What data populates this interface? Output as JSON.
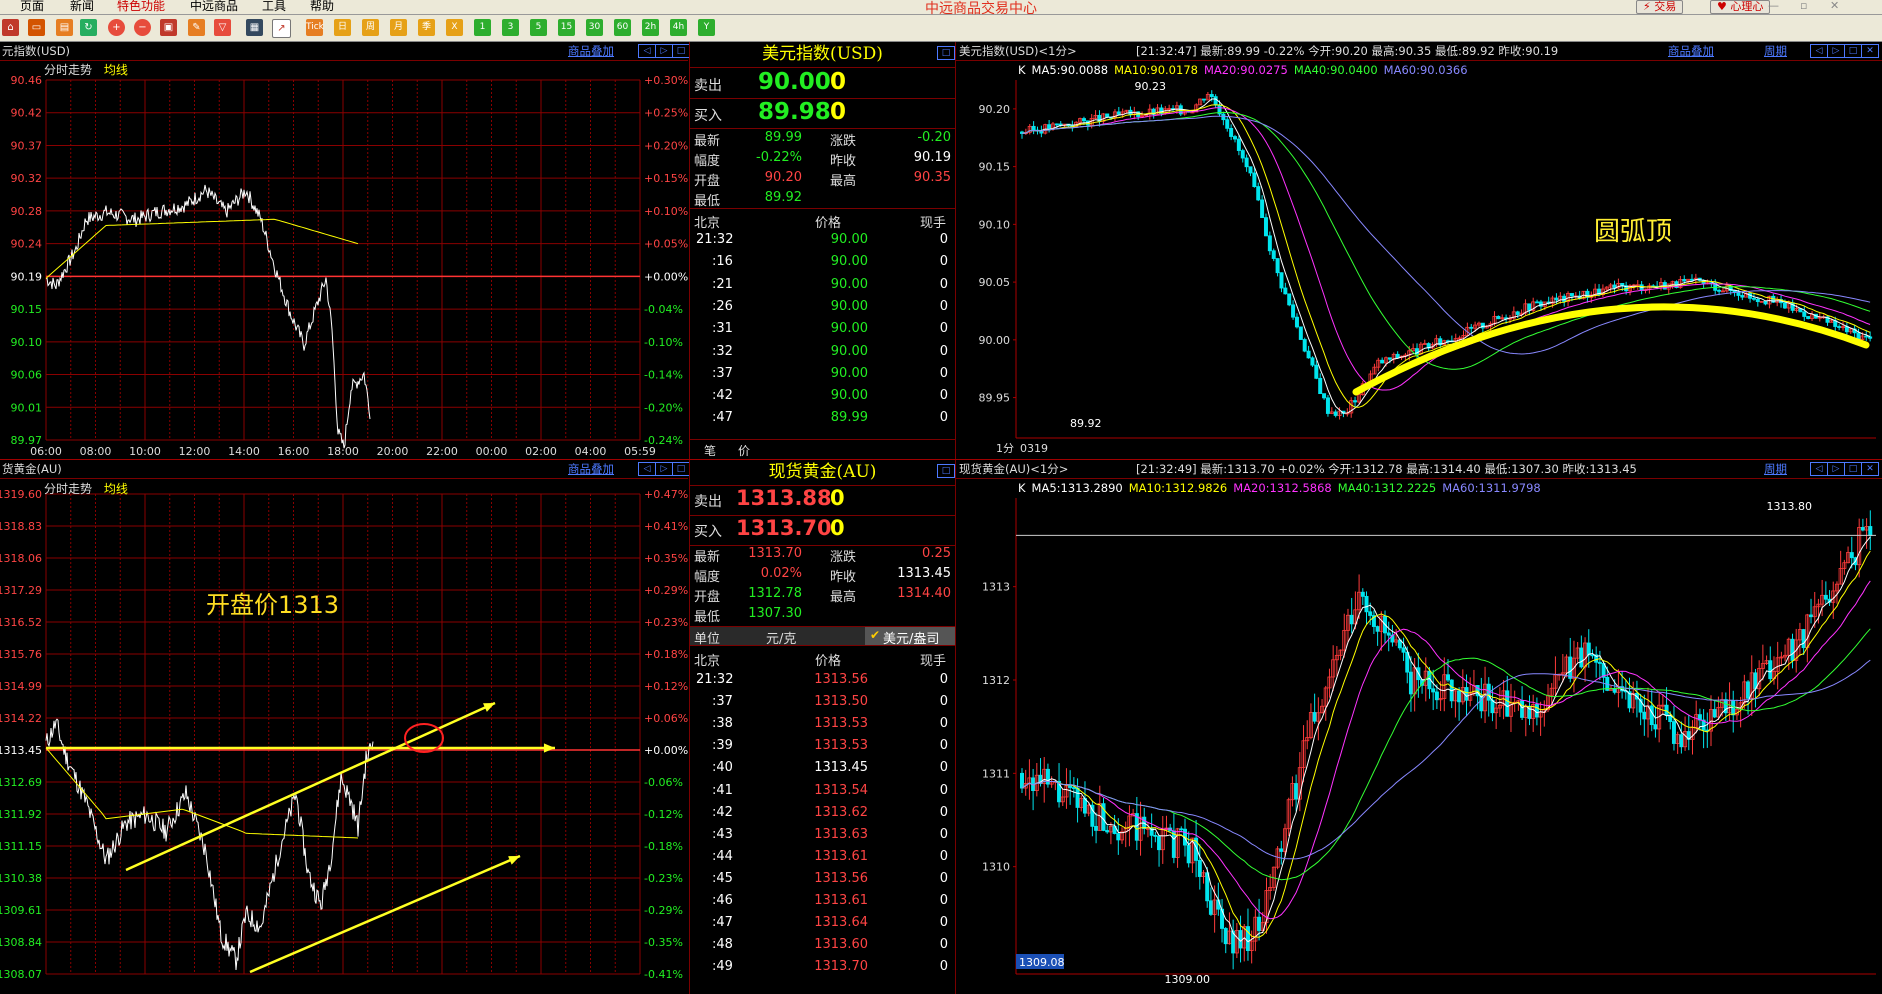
{
  "menu": {
    "items": [
      "页面",
      "新闻",
      "特色功能",
      "中远商品",
      "工具",
      "帮助"
    ],
    "app_title": "中远商品交易中心",
    "trade_btn": "交易",
    "center_btn": "心理心"
  },
  "toolbar": {
    "period_buttons": [
      "Tick",
      "日",
      "周",
      "月",
      "季",
      "X",
      "1",
      "3",
      "5",
      "15",
      "30",
      "60",
      "2h",
      "4h",
      "Y"
    ]
  },
  "usd_intraday": {
    "title": "元指数(USD)",
    "overlay_link": "商品叠加",
    "legend_time": "分时走势",
    "legend_avg": "均线",
    "price_ticks": [
      "90.46",
      "90.42",
      "90.37",
      "90.32",
      "90.28",
      "90.24",
      "90.19",
      "90.15",
      "90.10",
      "90.06",
      "90.01",
      "89.97"
    ],
    "pct_ticks": [
      "+0.30%",
      "+0.25%",
      "+0.20%",
      "+0.15%",
      "+0.10%",
      "+0.05%",
      "+0.00%",
      "-0.04%",
      "-0.10%",
      "-0.14%",
      "-0.20%",
      "-0.24%"
    ],
    "time_ticks": [
      "06:00",
      "08:00",
      "10:00",
      "12:00",
      "14:00",
      "16:00",
      "18:00",
      "20:00",
      "22:00",
      "00:00",
      "02:00",
      "04:00",
      "05:59"
    ]
  },
  "usd_quote": {
    "title": "美元指数(USD)",
    "sell_label": "卖出",
    "sell_price": "90.00",
    "sell_vol": "0",
    "buy_label": "买入",
    "buy_price": "89.98",
    "buy_vol": "0",
    "rows": [
      {
        "l1": "最新",
        "v1": "89.99",
        "c1": "g",
        "l2": "涨跌",
        "v2": "-0.20",
        "c2": "g"
      },
      {
        "l1": "幅度",
        "v1": "-0.22%",
        "c1": "g",
        "l2": "昨收",
        "v2": "90.19",
        "c2": "w"
      },
      {
        "l1": "开盘",
        "v1": "90.20",
        "c1": "r",
        "l2": "最高",
        "v2": "90.35",
        "c2": "r"
      },
      {
        "l1": "最低",
        "v1": "89.92",
        "c1": "g",
        "l2": "",
        "v2": "",
        "c2": "w"
      }
    ],
    "tick_head": [
      "北京",
      "价格",
      "现手"
    ],
    "ticks": [
      {
        "t": "21:32",
        "p": "90.00",
        "v": "0"
      },
      {
        "t": ":16",
        "p": "90.00",
        "v": "0"
      },
      {
        "t": ":21",
        "p": "90.00",
        "v": "0"
      },
      {
        "t": ":26",
        "p": "90.00",
        "v": "0"
      },
      {
        "t": ":31",
        "p": "90.00",
        "v": "0"
      },
      {
        "t": ":32",
        "p": "90.00",
        "v": "0"
      },
      {
        "t": ":37",
        "p": "90.00",
        "v": "0"
      },
      {
        "t": ":42",
        "p": "90.00",
        "v": "0"
      },
      {
        "t": ":47",
        "p": "89.99",
        "v": "0"
      }
    ],
    "tabs": [
      "笔",
      "价"
    ]
  },
  "usd_kline": {
    "title": "美元指数(USD)<1分>",
    "info": "[21:32:47] 最新:89.99 -0.22% 今开:90.20 最高:90.35 最低:89.92 昨收:90.19",
    "overlay_link": "商品叠加",
    "period_link": "周期",
    "ma": [
      {
        "t": "K",
        "c": "#ffffff"
      },
      {
        "t": "MA5:90.0088",
        "c": "#ffffff"
      },
      {
        "t": "MA10:90.0178",
        "c": "#ffff00"
      },
      {
        "t": "MA20:90.0275",
        "c": "#ff33ff"
      },
      {
        "t": "MA40:90.0400",
        "c": "#33ff33"
      },
      {
        "t": "MA60:90.0366",
        "c": "#8888ff"
      }
    ],
    "y_ticks": [
      "90.20",
      "90.15",
      "90.10",
      "90.05",
      "90.00",
      "89.95"
    ],
    "hi_label": "90.23",
    "lo_label": "89.92",
    "annotation": "圆弧顶",
    "period_label": "1分",
    "date_label": "0319"
  },
  "au_intraday": {
    "title": "货黄金(AU)",
    "overlay_link": "商品叠加",
    "legend_time": "分时走势",
    "legend_avg": "均线",
    "price_ticks": [
      "1319.60",
      "1318.83",
      "1318.06",
      "1317.29",
      "1316.52",
      "1315.76",
      "1314.99",
      "1314.22",
      "1313.45",
      "1312.69",
      "1311.92",
      "1311.15",
      "1310.38",
      "1309.61",
      "1308.84",
      "1308.07"
    ],
    "pct_ticks": [
      "+0.47%",
      "+0.41%",
      "+0.35%",
      "+0.29%",
      "+0.23%",
      "+0.18%",
      "+0.12%",
      "+0.06%",
      "+0.00%",
      "-0.06%",
      "-0.12%",
      "-0.18%",
      "-0.23%",
      "-0.29%",
      "-0.35%",
      "-0.41%"
    ],
    "annotation": "开盘价1313"
  },
  "au_quote": {
    "title": "现货黄金(AU)",
    "sell_label": "卖出",
    "sell_price": "1313.88",
    "sell_vol": "0",
    "buy_label": "买入",
    "buy_price": "1313.70",
    "buy_vol": "0",
    "rows": [
      {
        "l1": "最新",
        "v1": "1313.70",
        "c1": "r",
        "l2": "涨跌",
        "v2": "0.25",
        "c2": "r"
      },
      {
        "l1": "幅度",
        "v1": "0.02%",
        "c1": "r",
        "l2": "昨收",
        "v2": "1313.45",
        "c2": "w"
      },
      {
        "l1": "开盘",
        "v1": "1312.78",
        "c1": "g",
        "l2": "最高",
        "v2": "1314.40",
        "c2": "r"
      },
      {
        "l1": "最低",
        "v1": "1307.30",
        "c1": "g",
        "l2": "",
        "v2": "",
        "c2": "w"
      }
    ],
    "unit_label": "单位",
    "unit_a": "元/克",
    "unit_b": "美元/盎司",
    "tick_head": [
      "北京",
      "价格",
      "现手"
    ],
    "ticks": [
      {
        "t": "21:32",
        "p": "1313.56",
        "v": "0",
        "c": "r"
      },
      {
        "t": ":37",
        "p": "1313.50",
        "v": "0",
        "c": "r"
      },
      {
        "t": ":38",
        "p": "1313.53",
        "v": "0",
        "c": "r"
      },
      {
        "t": ":39",
        "p": "1313.53",
        "v": "0",
        "c": "r"
      },
      {
        "t": ":40",
        "p": "1313.45",
        "v": "0",
        "c": "w"
      },
      {
        "t": ":41",
        "p": "1313.54",
        "v": "0",
        "c": "r"
      },
      {
        "t": ":42",
        "p": "1313.62",
        "v": "0",
        "c": "r"
      },
      {
        "t": ":43",
        "p": "1313.63",
        "v": "0",
        "c": "r"
      },
      {
        "t": ":44",
        "p": "1313.61",
        "v": "0",
        "c": "r"
      },
      {
        "t": ":45",
        "p": "1313.56",
        "v": "0",
        "c": "r"
      },
      {
        "t": ":46",
        "p": "1313.61",
        "v": "0",
        "c": "r"
      },
      {
        "t": ":47",
        "p": "1313.64",
        "v": "0",
        "c": "r"
      },
      {
        "t": ":48",
        "p": "1313.60",
        "v": "0",
        "c": "r"
      },
      {
        "t": ":49",
        "p": "1313.70",
        "v": "0",
        "c": "r"
      }
    ]
  },
  "au_kline": {
    "title": "现货黄金(AU)<1分>",
    "info": "[21:32:49] 最新:1313.70 +0.02% 今开:1312.78 最高:1314.40 最低:1307.30 昨收:1313.45",
    "overlay_link": "商品叠加",
    "period_link": "周期",
    "ma": [
      {
        "t": "K",
        "c": "#ffffff"
      },
      {
        "t": "MA5:1313.2890",
        "c": "#ffffff"
      },
      {
        "t": "MA10:1312.9826",
        "c": "#ffff00"
      },
      {
        "t": "MA20:1312.5868",
        "c": "#ff33ff"
      },
      {
        "t": "MA40:1312.2225",
        "c": "#33ff33"
      },
      {
        "t": "MA60:1311.9798",
        "c": "#8888ff"
      }
    ],
    "y_ticks": [
      "1313",
      "1312",
      "1311",
      "1310"
    ],
    "hi_label": "1313.80",
    "lo_label": "1309.00",
    "cursor_label": "1309.08"
  }
}
